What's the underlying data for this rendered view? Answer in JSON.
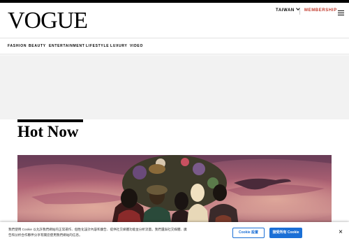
{
  "header": {
    "logo": "VOGUE",
    "region": "TAIWAN",
    "membership": "MEMBERSHIP"
  },
  "nav": {
    "items": [
      "FASHION",
      "BEAUTY",
      "ENTERTAINMENT",
      "LIFESTYLE",
      "LUXURY",
      "VIDEO"
    ]
  },
  "section": {
    "title": "Hot Now"
  },
  "cookie": {
    "text": "我們使用 Cookie 以允許我們網站的正常運作、個性化設計內容和廣告、提供社交媒體功能並分析流量。我們還與社交媒體、廣告和分析合作夥伴分享有關您使用我們網站的信息。",
    "settings_label": "Cookie 設置",
    "accept_label": "接受所有 Cookie",
    "close_label": "×"
  },
  "colors": {
    "membership": "#c0392b",
    "cookie_accent": "#1a6fd6",
    "ad_background": "#f2f2f2"
  }
}
